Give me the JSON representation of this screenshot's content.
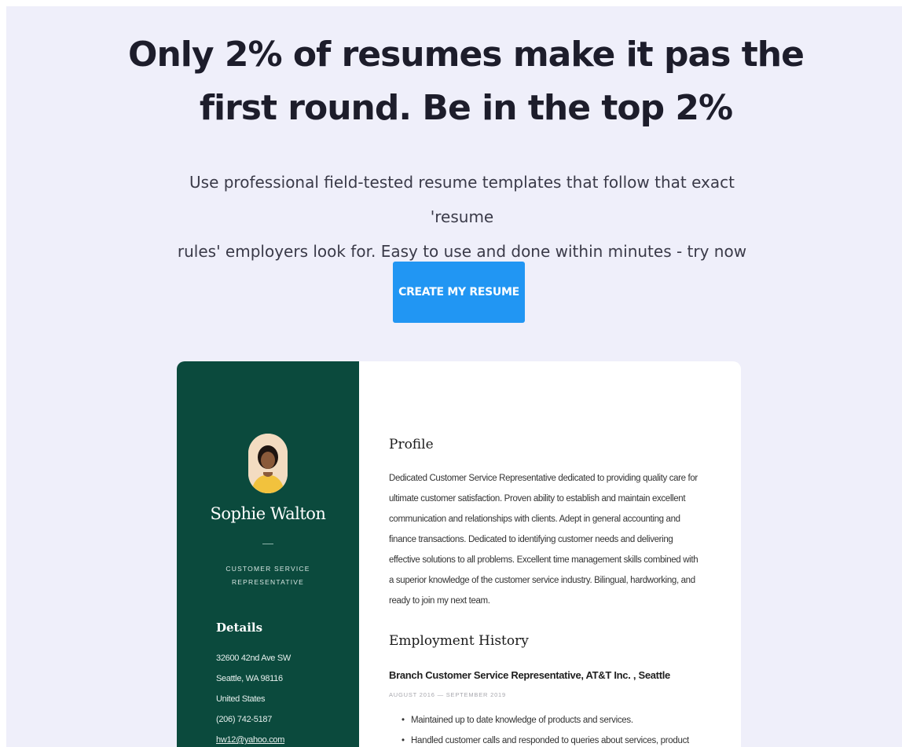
{
  "hero": {
    "headline_line1": "Only 2% of resumes make it pas the",
    "headline_line2": "first round. Be in the top 2%",
    "subtext_line1": "Use professional field-tested resume templates that follow that exact 'resume",
    "subtext_line2": "rules' employers look for. Easy to use and done within minutes - try now for free!",
    "cta_label": "CREATE MY RESUME"
  },
  "colors": {
    "background": "#efeffa",
    "cta": "#2196f3",
    "sidebar": "#0b4a3d"
  },
  "resume": {
    "name": "Sophie Walton",
    "job_title_line1": "CUSTOMER SERVICE",
    "job_title_line2": "REPRESENTATIVE",
    "details_heading": "Details",
    "details": {
      "street": "32600 42nd Ave SW",
      "city": "Seattle, WA 98116",
      "country": "United States",
      "phone": "(206) 742-5187",
      "email": "hw12@yahoo.com"
    },
    "profile_heading": "Profile",
    "profile_lines": [
      "Dedicated Customer Service Representative dedicated to providing quality care for",
      "ultimate customer satisfaction. Proven ability to establish and maintain excellent",
      "communication and relationships with clients. Adept in general accounting and",
      "finance transactions. Dedicated to identifying customer needs and delivering",
      "effective solutions to all problems. Excellent time management skills combined with",
      "a superior knowledge of the customer service industry. Bilingual, hardworking, and",
      "ready to join my next team."
    ],
    "employment_heading": "Employment History",
    "job": "Branch Customer Service Representative, AT&T Inc. , Seattle",
    "dates": "AUGUST 2016 — SEPTEMBER 2019",
    "bullets": [
      "Maintained up to date knowledge of products and services.",
      "Handled customer calls and responded to queries about services, product"
    ]
  }
}
